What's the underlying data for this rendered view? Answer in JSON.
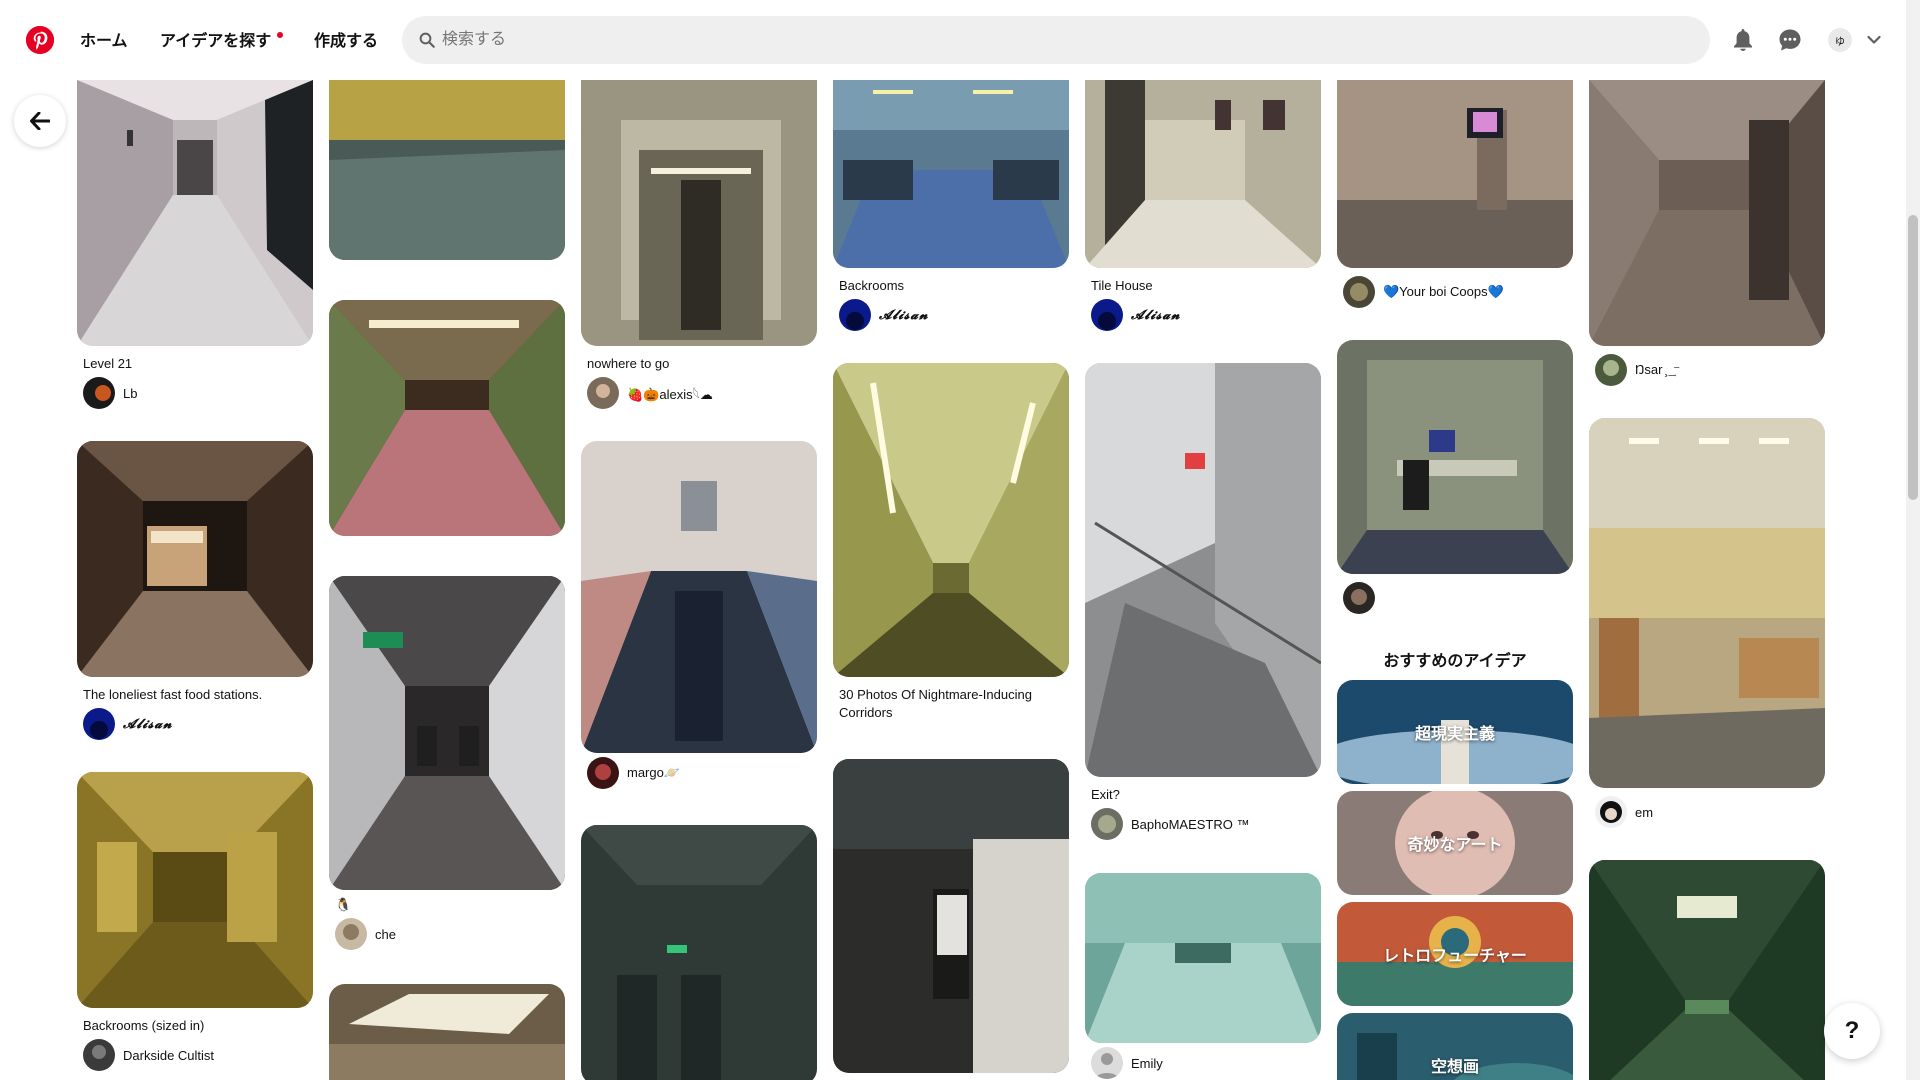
{
  "header": {
    "nav": {
      "home": "ホーム",
      "explore": "アイデアを探す",
      "create": "作成する"
    },
    "search": {
      "placeholder": "検索する",
      "value": ""
    },
    "avatar_initial": "ゆ",
    "icons": [
      "pinterest-logo",
      "search-icon",
      "bell-icon",
      "messages-icon",
      "chevron-down-icon"
    ]
  },
  "back_button": {
    "icon": "arrow-left-icon"
  },
  "pins": {
    "c1": [
      {
        "title": "Level 21",
        "user": "Lb"
      },
      {
        "title": "The loneliest fast food stations.",
        "user": "𝓐𝓵𝓲𝓼𝓪𝓷"
      },
      {
        "title": "Backrooms (sized in)",
        "user": "Darkside Cultist"
      }
    ],
    "c2": [
      {
        "user": "che",
        "badge": "🐧"
      }
    ],
    "c3": [
      {
        "title": "nowhere to go",
        "user": "🍓🎃alexis𓆩☁"
      },
      {
        "user": "margo🪐"
      }
    ],
    "c4": [
      {
        "title": "Backrooms",
        "user": "𝓐𝓵𝓲𝓼𝓪𝓷"
      },
      {
        "title": "30 Photos Of Nightmare-Inducing Corridors"
      }
    ],
    "c5": [
      {
        "title": "Tile House",
        "user": "𝓐𝓵𝓲𝓼𝓪𝓷"
      },
      {
        "title": "Exit?",
        "user": "BaphoMAESTRO ™"
      },
      {
        "user": "Emily"
      }
    ],
    "c6": [
      {
        "user": "💙Your boi Coops💙"
      }
    ],
    "c7": [
      {
        "user": "Ŋsar ̧ ͢ ⁻"
      },
      {
        "user": "em"
      }
    ]
  },
  "recommended": {
    "title": "おすすめのアイデア",
    "cards": [
      "超現実主義",
      "奇妙なアート",
      "レトロフューチャー",
      "空想画"
    ]
  },
  "help_button": {
    "label": "?"
  },
  "colors": {
    "brand": "#e60023",
    "progress": "#1976d2"
  }
}
